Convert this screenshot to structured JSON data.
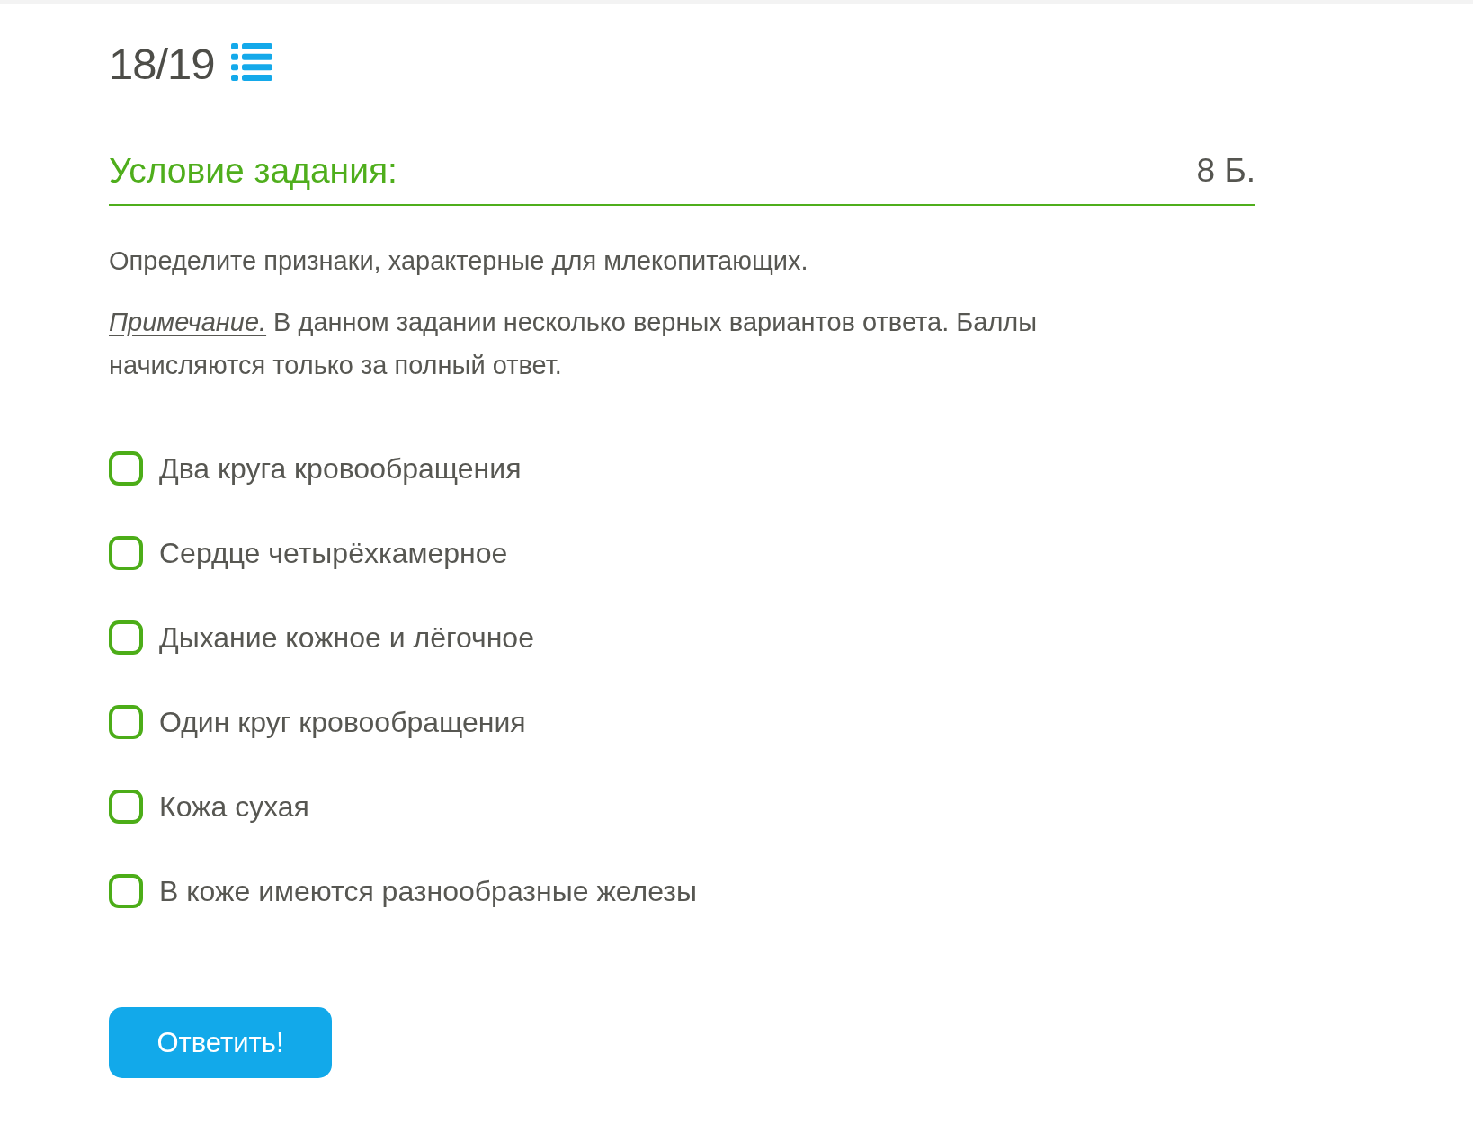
{
  "progress": {
    "counter": "18/19"
  },
  "task": {
    "heading": "Условие задания:",
    "points": "8 Б.",
    "question": "Определите признаки, характерные для млекопитающих.",
    "note": "*Примечание.* В данном задании несколько верных вариантов ответа. Баллы начисляются только за полный ответ."
  },
  "options": [
    {
      "label": "Два круга кровообращения",
      "checked": false
    },
    {
      "label": "Сердце четырёхкамерное",
      "checked": false
    },
    {
      "label": "Дыхание кожное и лёгочное",
      "checked": false
    },
    {
      "label": "Один круг кровообращения",
      "checked": false
    },
    {
      "label": "Кожа сухая",
      "checked": false
    },
    {
      "label": "В коже имеются разнообразные железы",
      "checked": false
    }
  ],
  "submit_button": {
    "label": "Ответить!"
  }
}
